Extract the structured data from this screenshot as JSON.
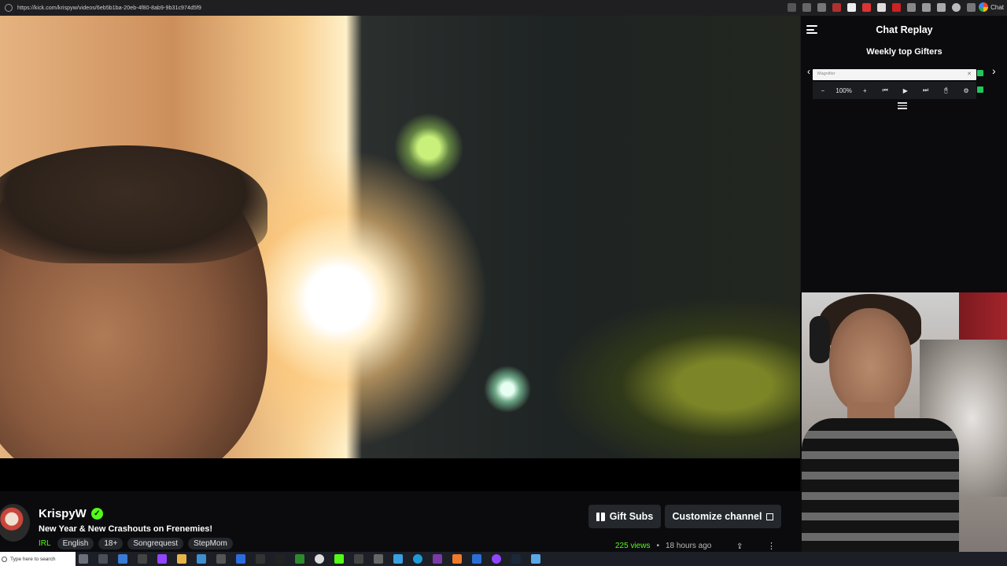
{
  "browser": {
    "url": "https://kick.com/krispyw/videos/6eb5b1ba-20eb-4f80-8ab9-9b31c974d5f9",
    "chat_extension_label": "Chat"
  },
  "channel": {
    "name": "KrispyW",
    "stream_title": "New Year & New Crashouts on Frenemies!",
    "category": "IRL",
    "tags": [
      "English",
      "18+",
      "Songrequest",
      "StepMom"
    ],
    "gift_button": "Gift Subs",
    "customize_button": "Customize channel",
    "views": "225 views",
    "separator": "•",
    "time_ago": "18 hours ago",
    "accent_color": "#53fc18"
  },
  "chat": {
    "title": "Chat Replay",
    "gifters_title": "Weekly top Gifters",
    "prev_glyph": "‹",
    "next_glyph": "›"
  },
  "magnifier": {
    "label": "Magnifier",
    "zoom": "100%",
    "minus": "−",
    "plus": "+",
    "prev": "⏮",
    "play": "▶",
    "next": "⏭",
    "follow": "🖰",
    "settings": "⚙"
  },
  "taskbar": {
    "search_placeholder": "Type here to search"
  }
}
